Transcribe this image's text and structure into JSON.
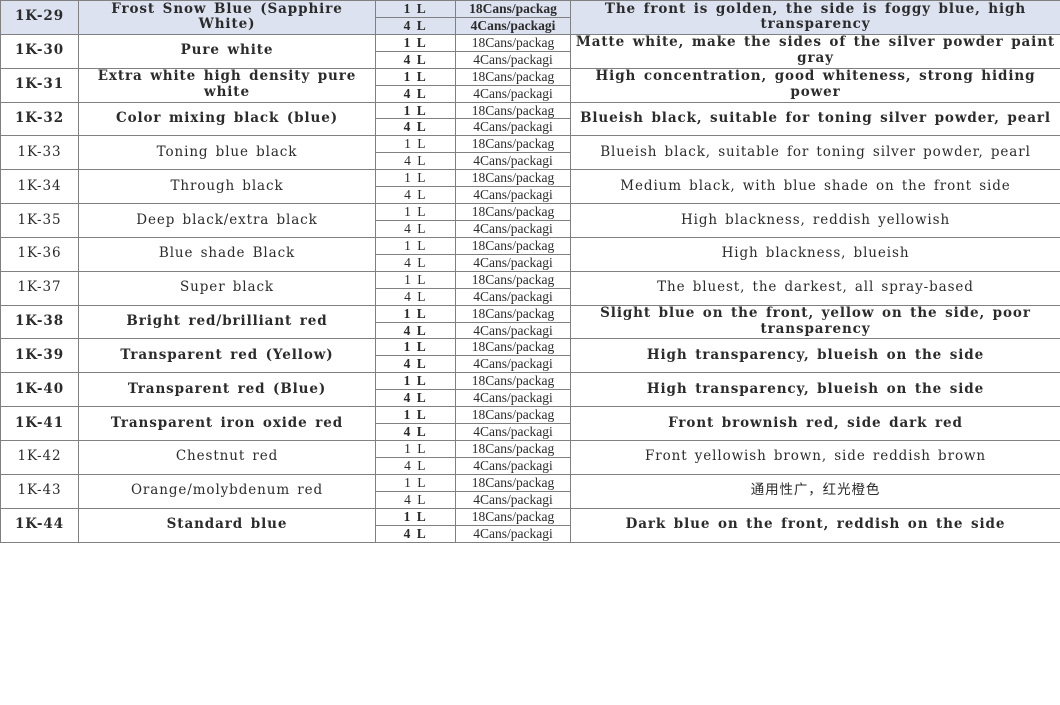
{
  "table": {
    "columns": [
      "code",
      "name",
      "volume",
      "packaging",
      "description"
    ],
    "volume_labels": {
      "small": "1 L",
      "large": "4 L"
    },
    "packaging_labels": {
      "small": "18Cans/packag",
      "large": "4Cans/packagi"
    },
    "highlight_color": "#dde2f0",
    "border_color": "#808080",
    "rows": [
      {
        "code": "1K-29",
        "name": "Frost Snow Blue (Sapphire White)",
        "volume_small": "1 L",
        "volume_large": "4 L",
        "pack_small": "18Cans/packag",
        "pack_large": "4Cans/packagi",
        "description": "The front is golden, the side is foggy blue, high transparency",
        "highlighted": true,
        "tone": "dark"
      },
      {
        "code": "1K-30",
        "name": "Pure white",
        "volume_small": "1 L",
        "volume_large": "4 L",
        "pack_small": "18Cans/packag",
        "pack_large": "4Cans/packagi",
        "description": "Matte white, make the sides of the silver powder paint gray",
        "highlighted": false,
        "tone": "dark"
      },
      {
        "code": "1K-31",
        "name": "Extra white high density pure white",
        "volume_small": "1 L",
        "volume_large": "4 L",
        "pack_small": "18Cans/packag",
        "pack_large": "4Cans/packagi",
        "description": "High concentration, good whiteness, strong hiding power",
        "highlighted": false,
        "tone": "dark"
      },
      {
        "code": "1K-32",
        "name": "Color mixing black (blue)",
        "volume_small": "1 L",
        "volume_large": "4 L",
        "pack_small": "18Cans/packag",
        "pack_large": "4Cans/packagi",
        "description": "Blueish black, suitable for toning silver powder, pearl",
        "highlighted": false,
        "tone": "dark"
      },
      {
        "code": "1K-33",
        "name": "Toning blue black",
        "volume_small": "1 L",
        "volume_large": "4 L",
        "pack_small": "18Cans/packag",
        "pack_large": "4Cans/packagi",
        "description": "Blueish black, suitable for toning silver powder, pearl",
        "highlighted": false,
        "tone": "mid"
      },
      {
        "code": "1K-34",
        "name": "Through black",
        "volume_small": "1 L",
        "volume_large": "4 L",
        "pack_small": "18Cans/packag",
        "pack_large": "4Cans/packagi",
        "description": "Medium black, with blue shade on the front side",
        "highlighted": false,
        "tone": "mid"
      },
      {
        "code": "1K-35",
        "name": "Deep black/extra black",
        "volume_small": "1 L",
        "volume_large": "4 L",
        "pack_small": "18Cans/packag",
        "pack_large": "4Cans/packagi",
        "description": "High blackness, reddish yellowish",
        "highlighted": false,
        "tone": "mid"
      },
      {
        "code": "1K-36",
        "name": "Blue shade Black",
        "volume_small": "1 L",
        "volume_large": "4 L",
        "pack_small": "18Cans/packag",
        "pack_large": "4Cans/packagi",
        "description": "High blackness, blueish",
        "highlighted": false,
        "tone": "mid"
      },
      {
        "code": "1K-37",
        "name": "Super black",
        "volume_small": "1 L",
        "volume_large": "4 L",
        "pack_small": "18Cans/packag",
        "pack_large": "4Cans/packagi",
        "description": "The bluest, the darkest, all spray-based",
        "highlighted": false,
        "tone": "mid"
      },
      {
        "code": "1K-38",
        "name": "Bright red/brilliant red",
        "volume_small": "1 L",
        "volume_large": "4 L",
        "pack_small": "18Cans/packag",
        "pack_large": "4Cans/packagi",
        "description": "Slight blue on the front, yellow on the side, poor transparency",
        "highlighted": false,
        "tone": "dark"
      },
      {
        "code": "1K-39",
        "name": "Transparent red (Yellow)",
        "volume_small": "1 L",
        "volume_large": "4 L",
        "pack_small": "18Cans/packag",
        "pack_large": "4Cans/packagi",
        "description": "High transparency, blueish on the side",
        "highlighted": false,
        "tone": "dark"
      },
      {
        "code": "1K-40",
        "name": "Transparent red (Blue)",
        "volume_small": "1 L",
        "volume_large": "4 L",
        "pack_small": "18Cans/packag",
        "pack_large": "4Cans/packagi",
        "description": "High transparency, blueish on the side",
        "highlighted": false,
        "tone": "dark"
      },
      {
        "code": "1K-41",
        "name": "Transparent iron oxide red",
        "volume_small": "1 L",
        "volume_large": "4 L",
        "pack_small": "18Cans/packag",
        "pack_large": "4Cans/packagi",
        "description": "Front brownish red, side dark red",
        "highlighted": false,
        "tone": "dark"
      },
      {
        "code": "1K-42",
        "name": "Chestnut red",
        "volume_small": "1 L",
        "volume_large": "4 L",
        "pack_small": "18Cans/packag",
        "pack_large": "4Cans/packagi",
        "description": "Front yellowish brown, side reddish brown",
        "highlighted": false,
        "tone": "mid"
      },
      {
        "code": "1K-43",
        "name": "Orange/molybdenum red",
        "volume_small": "1 L",
        "volume_large": "4 L",
        "pack_small": "18Cans/packag",
        "pack_large": "4Cans/packagi",
        "description": "通用性广，红光橙色",
        "highlighted": false,
        "tone": "light"
      },
      {
        "code": "1K-44",
        "name": "Standard blue",
        "volume_small": "1 L",
        "volume_large": "4 L",
        "pack_small": "18Cans/packag",
        "pack_large": "4Cans/packagi",
        "description": "Dark blue on the front, reddish on the side",
        "highlighted": false,
        "tone": "dark"
      }
    ]
  }
}
